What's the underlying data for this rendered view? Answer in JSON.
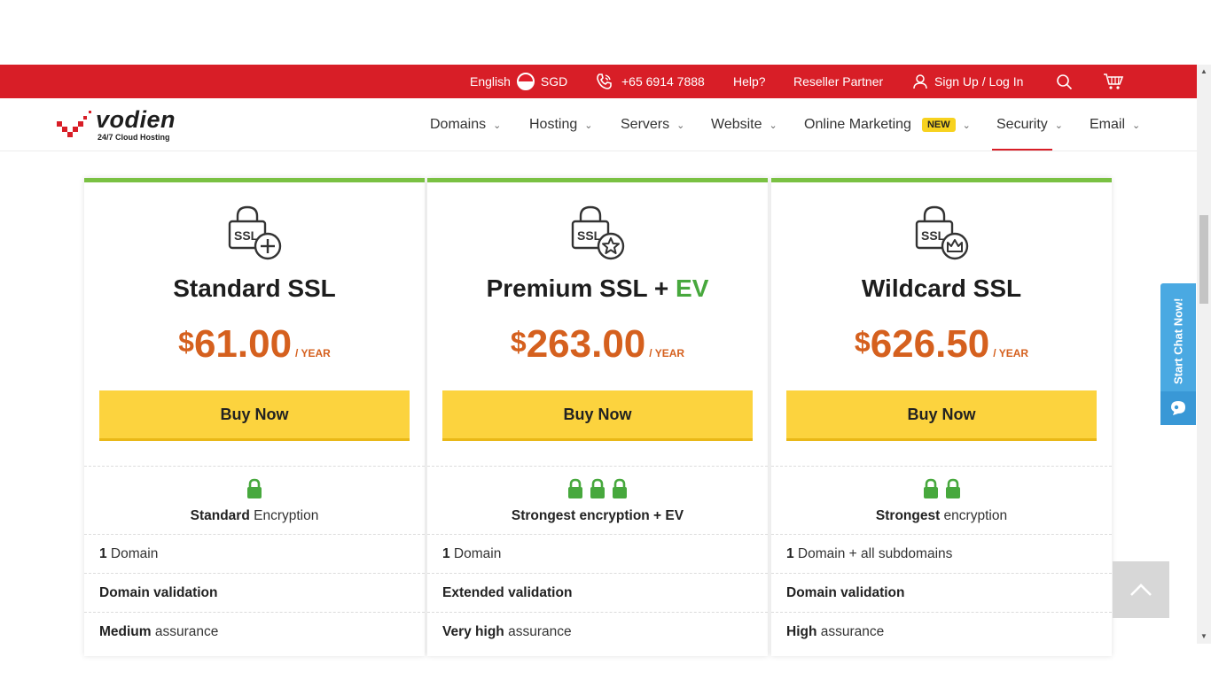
{
  "topbar": {
    "language": "English",
    "currency": "SGD",
    "phone": "+65 6914 7888",
    "help": "Help?",
    "reseller": "Reseller Partner",
    "signup": "Sign Up / Log In"
  },
  "logo": {
    "name": "vodien",
    "tagline": "24/7 Cloud Hosting"
  },
  "nav": {
    "domains": "Domains",
    "hosting": "Hosting",
    "servers": "Servers",
    "website": "Website",
    "online_marketing": "Online Marketing",
    "new_badge": "NEW",
    "security": "Security",
    "email": "Email"
  },
  "plans": [
    {
      "name": "Standard SSL",
      "name_suffix": "",
      "currency_symbol": "$",
      "price": "61.00",
      "period": "/ YEAR",
      "button": "Buy Now",
      "locks": 1,
      "encryption_bold": "Standard",
      "encryption_rest": " Encryption",
      "domain_bold": "1",
      "domain_rest": " Domain",
      "validation": "Domain validation",
      "assurance_bold": "Medium",
      "assurance_rest": " assurance"
    },
    {
      "name": "Premium SSL + ",
      "name_suffix": "EV",
      "currency_symbol": "$",
      "price": "263.00",
      "period": "/ YEAR",
      "button": "Buy Now",
      "locks": 3,
      "encryption_bold": "Strongest encryption + EV",
      "encryption_rest": "",
      "domain_bold": "1",
      "domain_rest": " Domain",
      "validation": "Extended validation",
      "assurance_bold": "Very high",
      "assurance_rest": " assurance"
    },
    {
      "name": "Wildcard SSL",
      "name_suffix": "",
      "currency_symbol": "$",
      "price": "626.50",
      "period": "/ YEAR",
      "button": "Buy Now",
      "locks": 2,
      "encryption_bold": "Strongest",
      "encryption_rest": " encryption",
      "domain_bold": "1",
      "domain_rest": " Domain + all subdomains",
      "validation": "Domain validation",
      "assurance_bold": "High",
      "assurance_rest": " assurance"
    }
  ],
  "ssl_icon_text": "SSL",
  "chat": {
    "label": "Start Chat Now!"
  },
  "colors": {
    "brand_red": "#d81e27",
    "card_accent": "#7ac143",
    "price": "#d5601e",
    "buy_button": "#fcd33e",
    "lock_green": "#47a83d",
    "chat_blue": "#4aa9e2"
  }
}
